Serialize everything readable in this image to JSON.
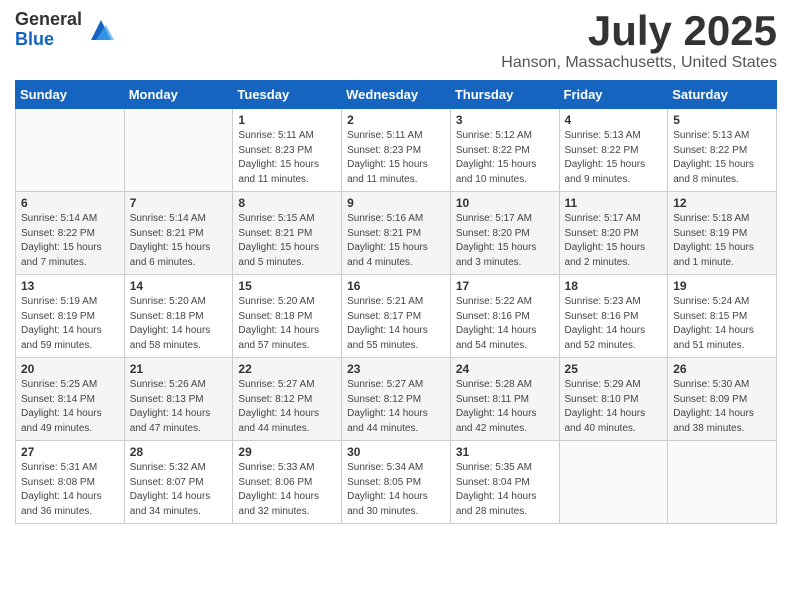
{
  "header": {
    "logo_general": "General",
    "logo_blue": "Blue",
    "month_title": "July 2025",
    "location": "Hanson, Massachusetts, United States"
  },
  "weekdays": [
    "Sunday",
    "Monday",
    "Tuesday",
    "Wednesday",
    "Thursday",
    "Friday",
    "Saturday"
  ],
  "weeks": [
    [
      {
        "day": "",
        "info": ""
      },
      {
        "day": "",
        "info": ""
      },
      {
        "day": "1",
        "info": "Sunrise: 5:11 AM\nSunset: 8:23 PM\nDaylight: 15 hours and 11 minutes."
      },
      {
        "day": "2",
        "info": "Sunrise: 5:11 AM\nSunset: 8:23 PM\nDaylight: 15 hours and 11 minutes."
      },
      {
        "day": "3",
        "info": "Sunrise: 5:12 AM\nSunset: 8:22 PM\nDaylight: 15 hours and 10 minutes."
      },
      {
        "day": "4",
        "info": "Sunrise: 5:13 AM\nSunset: 8:22 PM\nDaylight: 15 hours and 9 minutes."
      },
      {
        "day": "5",
        "info": "Sunrise: 5:13 AM\nSunset: 8:22 PM\nDaylight: 15 hours and 8 minutes."
      }
    ],
    [
      {
        "day": "6",
        "info": "Sunrise: 5:14 AM\nSunset: 8:22 PM\nDaylight: 15 hours and 7 minutes."
      },
      {
        "day": "7",
        "info": "Sunrise: 5:14 AM\nSunset: 8:21 PM\nDaylight: 15 hours and 6 minutes."
      },
      {
        "day": "8",
        "info": "Sunrise: 5:15 AM\nSunset: 8:21 PM\nDaylight: 15 hours and 5 minutes."
      },
      {
        "day": "9",
        "info": "Sunrise: 5:16 AM\nSunset: 8:21 PM\nDaylight: 15 hours and 4 minutes."
      },
      {
        "day": "10",
        "info": "Sunrise: 5:17 AM\nSunset: 8:20 PM\nDaylight: 15 hours and 3 minutes."
      },
      {
        "day": "11",
        "info": "Sunrise: 5:17 AM\nSunset: 8:20 PM\nDaylight: 15 hours and 2 minutes."
      },
      {
        "day": "12",
        "info": "Sunrise: 5:18 AM\nSunset: 8:19 PM\nDaylight: 15 hours and 1 minute."
      }
    ],
    [
      {
        "day": "13",
        "info": "Sunrise: 5:19 AM\nSunset: 8:19 PM\nDaylight: 14 hours and 59 minutes."
      },
      {
        "day": "14",
        "info": "Sunrise: 5:20 AM\nSunset: 8:18 PM\nDaylight: 14 hours and 58 minutes."
      },
      {
        "day": "15",
        "info": "Sunrise: 5:20 AM\nSunset: 8:18 PM\nDaylight: 14 hours and 57 minutes."
      },
      {
        "day": "16",
        "info": "Sunrise: 5:21 AM\nSunset: 8:17 PM\nDaylight: 14 hours and 55 minutes."
      },
      {
        "day": "17",
        "info": "Sunrise: 5:22 AM\nSunset: 8:16 PM\nDaylight: 14 hours and 54 minutes."
      },
      {
        "day": "18",
        "info": "Sunrise: 5:23 AM\nSunset: 8:16 PM\nDaylight: 14 hours and 52 minutes."
      },
      {
        "day": "19",
        "info": "Sunrise: 5:24 AM\nSunset: 8:15 PM\nDaylight: 14 hours and 51 minutes."
      }
    ],
    [
      {
        "day": "20",
        "info": "Sunrise: 5:25 AM\nSunset: 8:14 PM\nDaylight: 14 hours and 49 minutes."
      },
      {
        "day": "21",
        "info": "Sunrise: 5:26 AM\nSunset: 8:13 PM\nDaylight: 14 hours and 47 minutes."
      },
      {
        "day": "22",
        "info": "Sunrise: 5:27 AM\nSunset: 8:12 PM\nDaylight: 14 hours and 44 minutes."
      },
      {
        "day": "23",
        "info": "Sunrise: 5:27 AM\nSunset: 8:12 PM\nDaylight: 14 hours and 44 minutes."
      },
      {
        "day": "24",
        "info": "Sunrise: 5:28 AM\nSunset: 8:11 PM\nDaylight: 14 hours and 42 minutes."
      },
      {
        "day": "25",
        "info": "Sunrise: 5:29 AM\nSunset: 8:10 PM\nDaylight: 14 hours and 40 minutes."
      },
      {
        "day": "26",
        "info": "Sunrise: 5:30 AM\nSunset: 8:09 PM\nDaylight: 14 hours and 38 minutes."
      }
    ],
    [
      {
        "day": "27",
        "info": "Sunrise: 5:31 AM\nSunset: 8:08 PM\nDaylight: 14 hours and 36 minutes."
      },
      {
        "day": "28",
        "info": "Sunrise: 5:32 AM\nSunset: 8:07 PM\nDaylight: 14 hours and 34 minutes."
      },
      {
        "day": "29",
        "info": "Sunrise: 5:33 AM\nSunset: 8:06 PM\nDaylight: 14 hours and 32 minutes."
      },
      {
        "day": "30",
        "info": "Sunrise: 5:34 AM\nSunset: 8:05 PM\nDaylight: 14 hours and 30 minutes."
      },
      {
        "day": "31",
        "info": "Sunrise: 5:35 AM\nSunset: 8:04 PM\nDaylight: 14 hours and 28 minutes."
      },
      {
        "day": "",
        "info": ""
      },
      {
        "day": "",
        "info": ""
      }
    ]
  ]
}
